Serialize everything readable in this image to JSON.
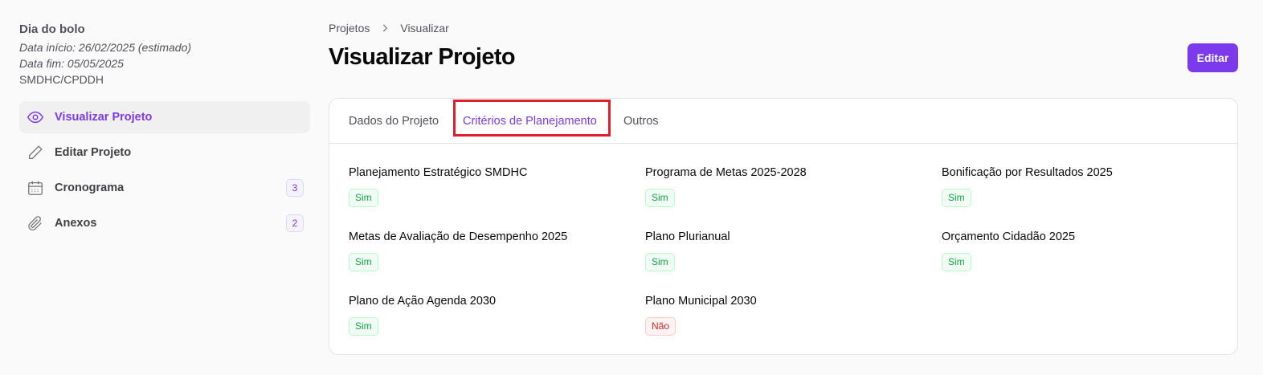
{
  "project": {
    "title": "Dia do bolo",
    "start": "Data início: 26/02/2025 (estimado)",
    "end": "Data fim: 05/05/2025",
    "org": "SMDHC/CPDDH"
  },
  "nav": {
    "items": [
      {
        "label": "Visualizar Projeto",
        "icon": "eye-icon"
      },
      {
        "label": "Editar Projeto",
        "icon": "pencil-icon"
      },
      {
        "label": "Cronograma",
        "icon": "calendar-icon",
        "badge": "3"
      },
      {
        "label": "Anexos",
        "icon": "paperclip-icon",
        "badge": "2"
      }
    ]
  },
  "breadcrumb": {
    "root": "Projetos",
    "current": "Visualizar"
  },
  "page": {
    "title": "Visualizar Projeto",
    "edit_label": "Editar"
  },
  "tabs": [
    {
      "label": "Dados do Projeto"
    },
    {
      "label": "Critérios de Planejamento"
    },
    {
      "label": "Outros"
    }
  ],
  "criteria": [
    {
      "label": "Planejamento Estratégico SMDHC",
      "value": "Sim"
    },
    {
      "label": "Programa de Metas 2025-2028",
      "value": "Sim"
    },
    {
      "label": "Bonificação por Resultados 2025",
      "value": "Sim"
    },
    {
      "label": "Metas de Avaliação de Desempenho 2025",
      "value": "Sim"
    },
    {
      "label": "Plano Plurianual",
      "value": "Sim"
    },
    {
      "label": "Orçamento Cidadão 2025",
      "value": "Sim"
    },
    {
      "label": "Plano de Ação Agenda 2030",
      "value": "Sim"
    },
    {
      "label": "Plano Municipal 2030",
      "value": "Não"
    }
  ],
  "colors": {
    "accent": "#7c3aed",
    "yes": "#16a34a",
    "no": "#dc2626",
    "highlight": "#e11d2e"
  }
}
